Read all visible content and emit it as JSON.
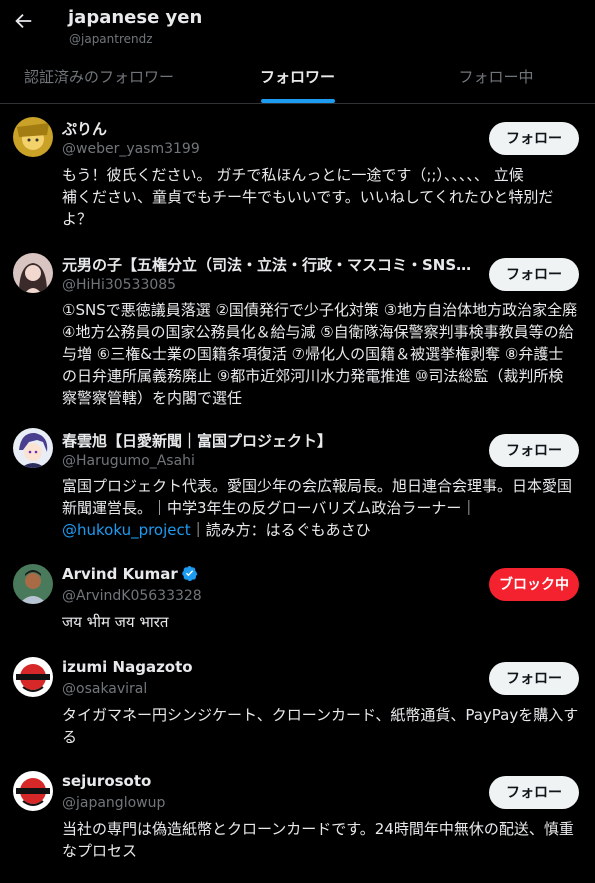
{
  "header": {
    "title": "japanese yen",
    "handle": "@japantrendz"
  },
  "tabs": [
    {
      "label": "認証済みのフォロワー",
      "active": false
    },
    {
      "label": "フォロワー",
      "active": true
    },
    {
      "label": "フォロー中",
      "active": false
    }
  ],
  "users": [
    {
      "name": "ぷりん",
      "handle": "@weber_yasm3199",
      "bio": [
        "もう！彼氏ください。 ガチで私ほんっとに一途です（;;）、、、、、 立候",
        "補ください、童貞でもチー牛でもいいです。いいねしてくれたひと特別だ",
        "よ？"
      ],
      "button": "フォロー"
    },
    {
      "name": "元男の子【五権分立（司法・立法・行政・マスコミ・SNS…",
      "handle": "@HiHi30533085",
      "bio": [
        "①SNSで悪徳議員落選 ②国債発行で少子化対策 ③地方自治体地方政治家全廃",
        "④地方公務員の国家公務員化＆給与減 ⑤自衛隊海保警察判事検事教員等の給",
        "与増 ⑥三権&士業の国籍条項復活 ⑦帰化人の国籍＆被選挙権剥奪 ⑧弁護士",
        "の日弁連所属義務廃止 ⑨都市近郊河川水力発電推進 ⑩司法総監（裁判所検",
        "察警察管轄）を内閣で選任"
      ],
      "button": "フォロー"
    },
    {
      "name": "春雲旭【日愛新聞｜富国プロジェクト】",
      "handle": "@Harugumo_Asahi",
      "bio": [
        "富国プロジェクト代表。愛国少年の会広報局長。旭日連合会理事。日本愛国",
        "新聞運営長。｜中学3年生の反グローバリズム政治ラーナー｜"
      ],
      "bio_link": "@hukoku_project",
      "bio_tail": "｜読み方：はるぐもあさひ",
      "button": "フォロー"
    },
    {
      "name": "Arvind Kumar",
      "handle": "@ArvindK05633328",
      "bio": [
        "जय भीम जय भारत"
      ],
      "button": "ブロック中"
    },
    {
      "name": "izumi Nagazoto",
      "handle": "@osakaviral",
      "bio": [
        "タイガマネー円シンジケート、クローンカード、紙幣通貨、PayPayを購入す",
        "る"
      ],
      "button": "フォロー"
    },
    {
      "name": "sejurosoto",
      "handle": "@japanglowup",
      "bio": [
        "当社の専門は偽造紙幣とクローンカードです。24時間年中無休の配送、慎重",
        "なプロセス"
      ],
      "button": "フォロー"
    }
  ],
  "colors": {
    "accent": "#1d9bf0",
    "block": "#f4212e",
    "muted": "#71767b"
  }
}
